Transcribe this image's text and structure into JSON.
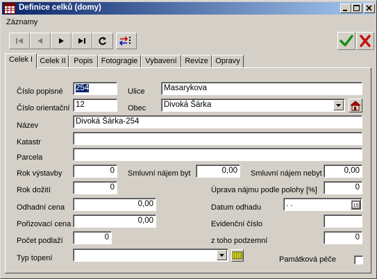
{
  "window": {
    "title": "Definice celků (domy)",
    "app_icon_text": "HELIOS"
  },
  "menu": {
    "items": [
      "Záznamy"
    ]
  },
  "tabs": [
    "Celek I",
    "Celek II",
    "Popis",
    "Fotogragie",
    "Vybavení",
    "Revize",
    "Opravy"
  ],
  "active_tab": "Celek I",
  "form": {
    "cislo_popisne": {
      "label": "Číslo popisné",
      "value": "254"
    },
    "ulice": {
      "label": "Ulice",
      "value": "Masarykova"
    },
    "cislo_orientacni": {
      "label": "Číslo orientační",
      "value": "12"
    },
    "obec": {
      "label": "Obec",
      "value": "Divoká Šárka"
    },
    "nazev": {
      "label": "Název",
      "value": "Divoká Šárka-254"
    },
    "katastr": {
      "label": "Katastr",
      "value": ""
    },
    "parcela": {
      "label": "Parcela",
      "value": ""
    },
    "rok_vystavby": {
      "label": "Rok výstavby",
      "value": "0"
    },
    "smluvni_najem_byt": {
      "label": "Smluvní nájem byt",
      "value": "0,00"
    },
    "smluvni_najem_nebyt": {
      "label": "Smluvní nájem nebyt",
      "value": "0,00"
    },
    "rok_doziti": {
      "label": "Rok dožití",
      "value": "0"
    },
    "uprava_najmu": {
      "label": "Úprava nájmu podle polohy [%]",
      "value": "0"
    },
    "odhadni_cena": {
      "label": "Odhadní cena",
      "value": "0,00"
    },
    "datum_odhadu": {
      "label": "Datum odhadu",
      "value": " .  ."
    },
    "porizovaci_cena": {
      "label": "Pořizovací cena",
      "value": "0,00"
    },
    "evidencni_cislo": {
      "label": "Evidenční číslo",
      "value": ""
    },
    "pocet_podlazi": {
      "label": "Počet podlaží",
      "value": "0"
    },
    "z_toho_podzemni": {
      "label": "z toho podzemní",
      "value": "0"
    },
    "typ_topeni": {
      "label": "Typ topení",
      "value": ""
    },
    "pamatkova_pece": {
      "label": "Památková péče",
      "checked": false
    }
  },
  "calendar_button_label": "15",
  "colors": {
    "title_start": "#0a246a",
    "title_end": "#a6caf0",
    "ok_green": "#1a8f1a",
    "cancel_red": "#c81010",
    "face": "#d4d0c8"
  }
}
